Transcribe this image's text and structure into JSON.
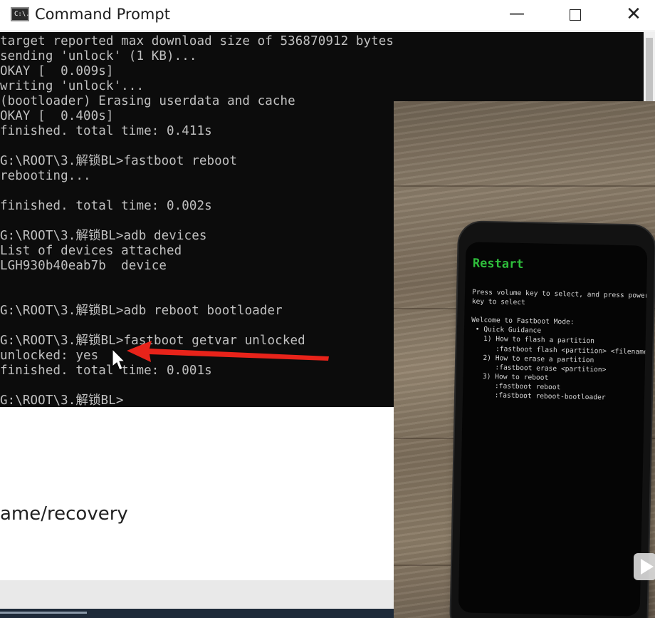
{
  "window": {
    "title": "Command Prompt",
    "icon_text": "C:\\.",
    "minimize_label": "—",
    "close_label": "✕"
  },
  "console": {
    "lines": [
      "target reported max download size of 536870912 bytes",
      "sending 'unlock' (1 KB)...",
      "OKAY [  0.009s]",
      "writing 'unlock'...",
      "(bootloader) Erasing userdata and cache",
      "OKAY [  0.400s]",
      "finished. total time: 0.411s",
      "",
      "G:\\ROOT\\3.解锁BL>fastboot reboot",
      "rebooting...",
      "",
      "finished. total time: 0.002s",
      "",
      "G:\\ROOT\\3.解锁BL>adb devices",
      "List of devices attached",
      "LGH930b40eab7b  device",
      "",
      "",
      "G:\\ROOT\\3.解锁BL>adb reboot bootloader",
      "",
      "G:\\ROOT\\3.解锁BL>fastboot getvar unlocked",
      "unlocked: yes",
      "finished. total time: 0.001s",
      "",
      "G:\\ROOT\\3.解锁BL>"
    ]
  },
  "document": {
    "visible_text": "ame/recovery"
  },
  "phone": {
    "menu_title": "Restart",
    "lines": [
      "Press volume key to select, and press power",
      "key to select",
      "",
      "Welcome to Fastboot Mode:",
      " • Quick Guidance",
      "   1) How to flash a partition",
      "      :fastboot flash <partition> <filename>",
      "   2) How to erase a partition",
      "      :fastboot erase <partition>",
      "   3) How to reboot",
      "      :fastboot reboot",
      "      :fastboot reboot-bootloader"
    ]
  },
  "colors": {
    "console_bg": "#0c0c0c",
    "console_text": "#c0c0c0",
    "annotation_arrow": "#e8231a",
    "phone_menu_title": "#2fbf3c"
  },
  "icons": {
    "app": "cmd-icon",
    "minimize": "minimize-icon",
    "maximize": "maximize-icon",
    "close": "close-icon",
    "cursor": "mouse-cursor-icon",
    "arrow": "red-arrow-annotation",
    "play": "play-icon"
  }
}
